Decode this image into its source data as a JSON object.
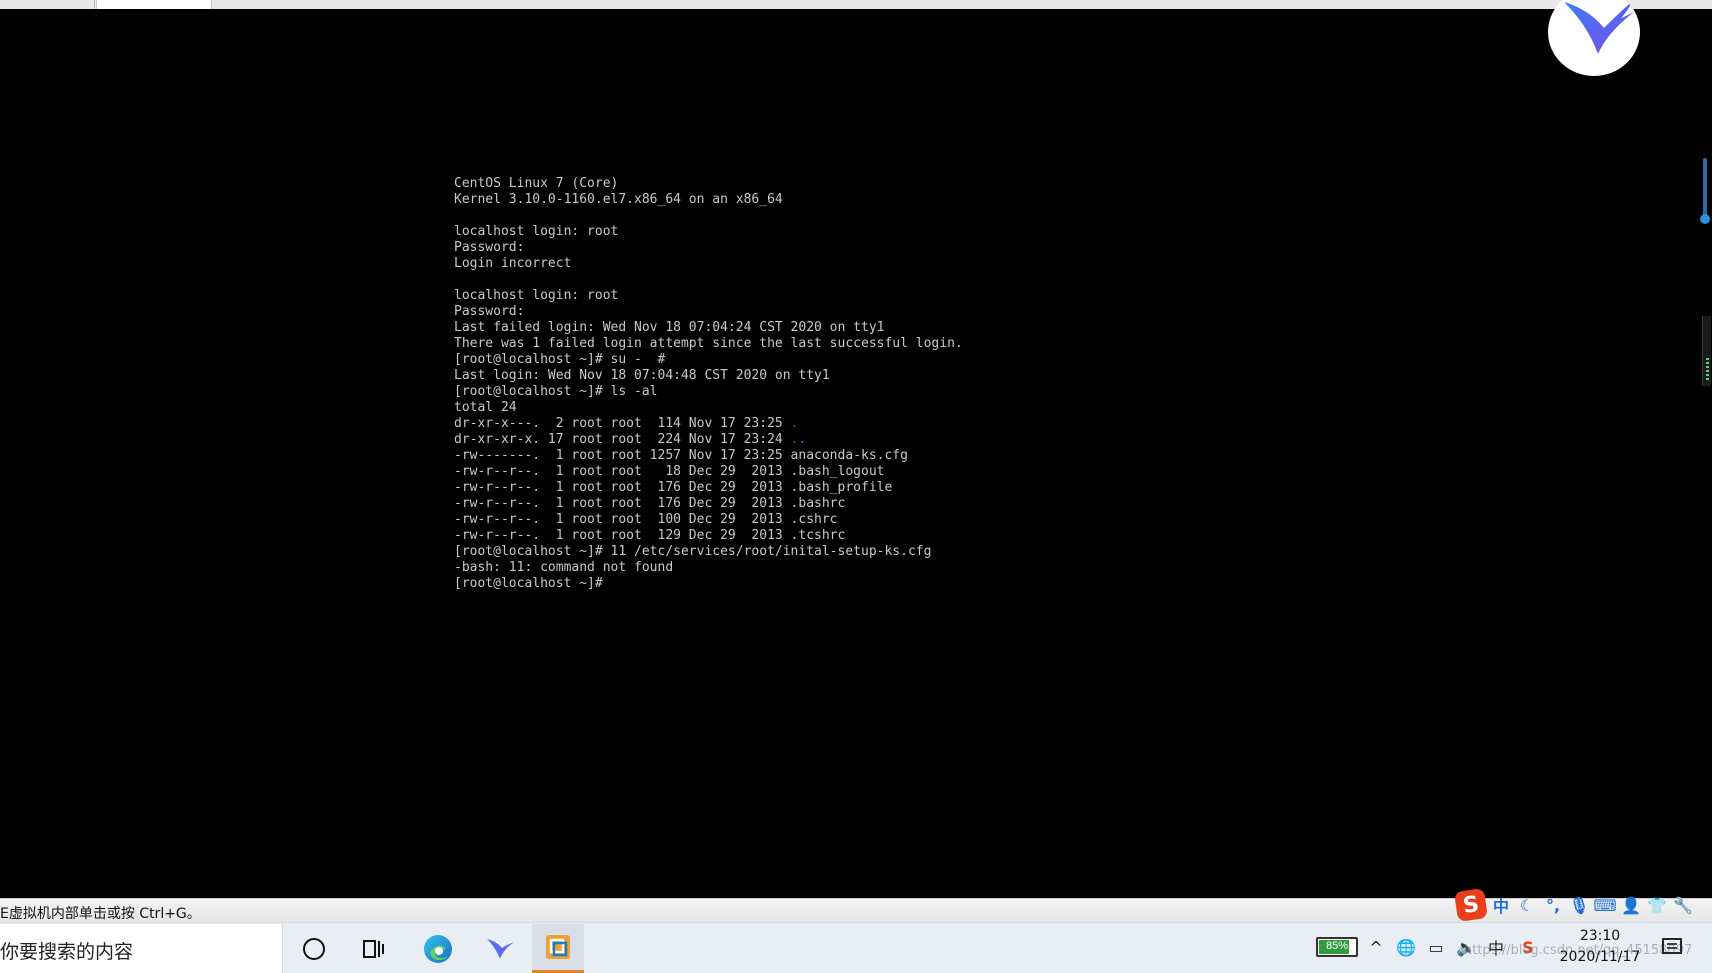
{
  "console": {
    "lines": [
      {
        "text": "CentOS Linux 7 (Core)"
      },
      {
        "text": "Kernel 3.10.0-1160.el7.x86_64 on an x86_64"
      },
      {
        "text": ""
      },
      {
        "text": "localhost login: root"
      },
      {
        "text": "Password:"
      },
      {
        "text": "Login incorrect"
      },
      {
        "text": ""
      },
      {
        "text": "localhost login: root"
      },
      {
        "text": "Password:"
      },
      {
        "text": "Last failed login: Wed Nov 18 07:04:24 CST 2020 on tty1"
      },
      {
        "text": "There was 1 failed login attempt since the last successful login."
      },
      {
        "text": "[root@localhost ~]# su -  #"
      },
      {
        "text": "Last login: Wed Nov 18 07:04:48 CST 2020 on tty1"
      },
      {
        "text": "[root@localhost ~]# ls -al"
      },
      {
        "text": "total 24"
      },
      {
        "text": "dr-xr-x---.  2 root root  114 Nov 17 23:25 ",
        "highlight": "."
      },
      {
        "text": "dr-xr-xr-x. 17 root root  224 Nov 17 23:24 ",
        "highlight": ".."
      },
      {
        "text": "-rw-------.  1 root root 1257 Nov 17 23:25 anaconda-ks.cfg"
      },
      {
        "text": "-rw-r--r--.  1 root root   18 Dec 29  2013 .bash_logout"
      },
      {
        "text": "-rw-r--r--.  1 root root  176 Dec 29  2013 .bash_profile"
      },
      {
        "text": "-rw-r--r--.  1 root root  176 Dec 29  2013 .bashrc"
      },
      {
        "text": "-rw-r--r--.  1 root root  100 Dec 29  2013 .cshrc"
      },
      {
        "text": "-rw-r--r--.  1 root root  129 Dec 29  2013 .tcshrc"
      },
      {
        "text": "[root@localhost ~]# 11 /etc/services/root/inital-setup-ks.cfg"
      },
      {
        "text": "-bash: 11: command not found"
      },
      {
        "text": "[root@localhost ~]#"
      }
    ],
    "text_color": "#c8c8c8",
    "dir_color": "#3b5bdb"
  },
  "hint_bar": {
    "text": "E虚拟机内部单击或按 Ctrl+G。"
  },
  "ime": {
    "logo": "S",
    "items": [
      {
        "icon": "chinese-mode-icon",
        "glyph": "中"
      },
      {
        "icon": "moon-icon",
        "glyph": "☾"
      },
      {
        "icon": "punctuation-icon",
        "glyph": "°,"
      },
      {
        "icon": "microphone-icon",
        "glyph": "🎙"
      },
      {
        "icon": "keyboard-icon",
        "glyph": "⌨"
      },
      {
        "icon": "user-icon",
        "glyph": "👤"
      },
      {
        "icon": "shirt-icon",
        "glyph": "👕"
      },
      {
        "icon": "wrench-icon",
        "glyph": "🔧"
      }
    ]
  },
  "taskbar": {
    "search_placeholder": "你要搜索的内容",
    "apps": [
      {
        "icon": "cortana-icon"
      },
      {
        "icon": "task-view-icon"
      },
      {
        "icon": "edge-browser-icon"
      },
      {
        "icon": "feishu-bird-icon"
      },
      {
        "icon": "vmware-icon",
        "active": true
      }
    ],
    "battery_percent": "85%",
    "battery_level": 0.85,
    "tray": [
      {
        "icon": "chevron-up-icon",
        "glyph": "^"
      },
      {
        "icon": "globe-icon",
        "glyph": "🌐"
      },
      {
        "icon": "battery-icon",
        "glyph": "▭"
      },
      {
        "icon": "volume-icon",
        "glyph": "🔈"
      },
      {
        "icon": "ime-indicator-icon",
        "glyph": "中"
      },
      {
        "icon": "sogou-icon",
        "glyph": "S"
      }
    ],
    "time": "23:10",
    "date": "2020/11/17",
    "watermark": "https://blog.csdn.net/qq_45158097"
  },
  "colors": {
    "accent_orange": "#e0862a",
    "battery_green": "#2e9b3e",
    "sogou_red": "#e8401c",
    "ime_blue": "#1e6fd9"
  }
}
